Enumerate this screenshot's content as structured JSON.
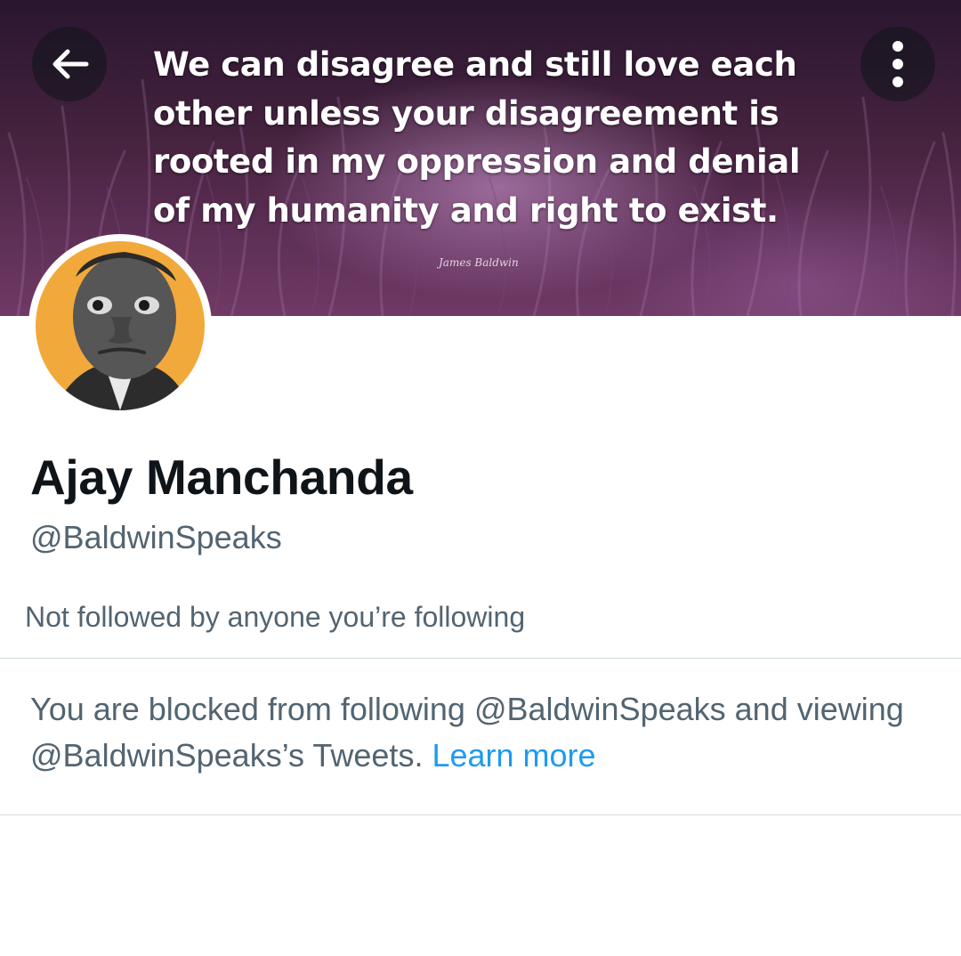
{
  "header": {
    "banner": {
      "quote_lines": [
        "We can disagree and still love each",
        "other unless your disagreement is",
        "rooted in my oppression and denial",
        "of my humanity and right to exist."
      ],
      "attribution": "James Baldwin"
    },
    "back_icon": "arrow-left-icon",
    "more_icon": "more-vertical-icon"
  },
  "profile": {
    "display_name": "Ajay Manchanda",
    "handle": "@BaldwinSpeaks",
    "followed_by": "Not followed by anyone you’re following",
    "avatar_background": "#f2a93b"
  },
  "blocked_notice": {
    "text": "You are blocked from following @BaldwinSpeaks and viewing @BaldwinSpeaks’s Tweets.",
    "link_label": "Learn more"
  },
  "colors": {
    "text_primary": "#0f1419",
    "text_secondary": "#536471",
    "link": "#1d9bf0",
    "divider": "#cfd9de"
  }
}
